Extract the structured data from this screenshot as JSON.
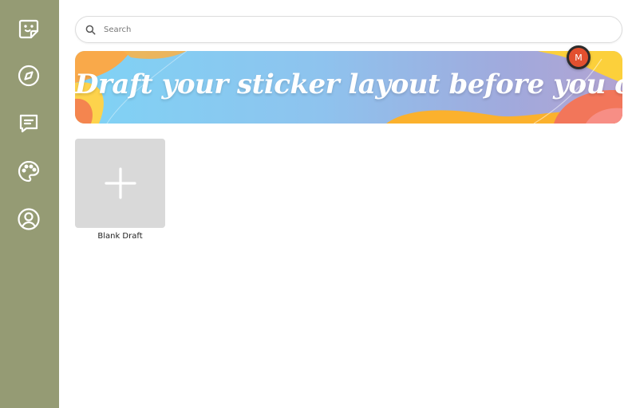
{
  "sidebar": {
    "items": [
      {
        "name": "stickers",
        "icon": "sticker-icon"
      },
      {
        "name": "explore",
        "icon": "compass-icon"
      },
      {
        "name": "messages",
        "icon": "chat-icon"
      },
      {
        "name": "palette",
        "icon": "palette-icon"
      },
      {
        "name": "profile",
        "icon": "user-icon"
      }
    ]
  },
  "search": {
    "placeholder": "Search",
    "icon": "search-icon"
  },
  "banner": {
    "text": "Draft your sticker layout before you commit!"
  },
  "avatar": {
    "initial": "M"
  },
  "drafts": {
    "blank_label": "Blank Draft",
    "icon": "plus-icon"
  },
  "colors": {
    "sidebar": "#959b74",
    "card": "#d9d9d9",
    "avatar": "#e2502f"
  }
}
